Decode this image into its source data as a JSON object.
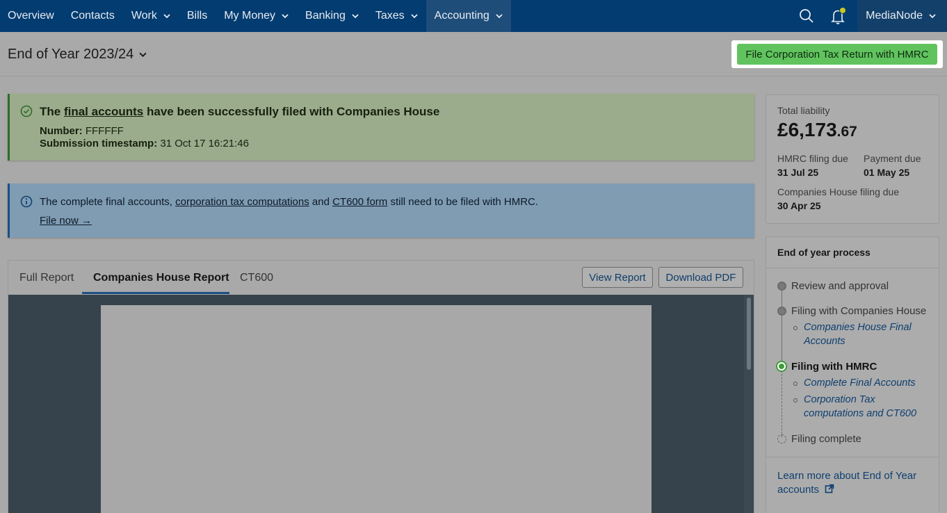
{
  "nav": {
    "items": [
      {
        "label": "Overview",
        "dropdown": false
      },
      {
        "label": "Contacts",
        "dropdown": false
      },
      {
        "label": "Work",
        "dropdown": true
      },
      {
        "label": "Bills",
        "dropdown": false
      },
      {
        "label": "My Money",
        "dropdown": true
      },
      {
        "label": "Banking",
        "dropdown": true
      },
      {
        "label": "Taxes",
        "dropdown": true
      },
      {
        "label": "Accounting",
        "dropdown": true,
        "active": true
      }
    ],
    "org_name": "MediaNode",
    "icons": [
      "search-icon",
      "bell-icon",
      "chevron-down-icon"
    ],
    "colors": {
      "bar": "#033c71",
      "active": "#1e4d7a"
    }
  },
  "header": {
    "title": "End of Year 2023/24",
    "file_button": "File Corporation Tax Return with HMRC"
  },
  "success": {
    "title_pre": "The ",
    "title_link": "final accounts",
    "title_post": " have been successfully filed with Companies House",
    "number_label": "Number:",
    "number_value": "FFFFFF",
    "timestamp_label": "Submission timestamp:",
    "timestamp_value": "31 Oct 17 16:21:46"
  },
  "info": {
    "text_1": "The complete final accounts, ",
    "link_1": "corporation tax computations",
    "text_2": " and ",
    "link_2": "CT600 form",
    "text_3": " still need to be filed with HMRC.",
    "action": "File now →"
  },
  "report": {
    "tabs": [
      {
        "label": "Full Report"
      },
      {
        "label": "Companies House Report",
        "active": true
      },
      {
        "label": "CT600"
      }
    ],
    "view_button": "View Report",
    "download_button": "Download PDF"
  },
  "liability": {
    "label": "Total liability",
    "amount_main": "£6,173",
    "amount_pence": ".67",
    "hmrc_due_label": "HMRC filing due",
    "hmrc_due_value": "31 Jul 25",
    "payment_due_label": "Payment due",
    "payment_due_value": "01 May 25",
    "ch_due_label": "Companies House filing due",
    "ch_due_value": "30 Apr 25"
  },
  "process": {
    "title": "End of year process",
    "steps": [
      {
        "label": "Review and approval",
        "state": "done"
      },
      {
        "label": "Filing with Companies House",
        "state": "done",
        "subs": [
          "Companies House Final Accounts"
        ]
      },
      {
        "label": "Filing with HMRC",
        "state": "current",
        "subs": [
          "Complete Final Accounts",
          "Corporation Tax computations and CT600"
        ]
      },
      {
        "label": "Filing complete",
        "state": "pending"
      }
    ],
    "learn_more": "Learn more about End of Year accounts"
  }
}
